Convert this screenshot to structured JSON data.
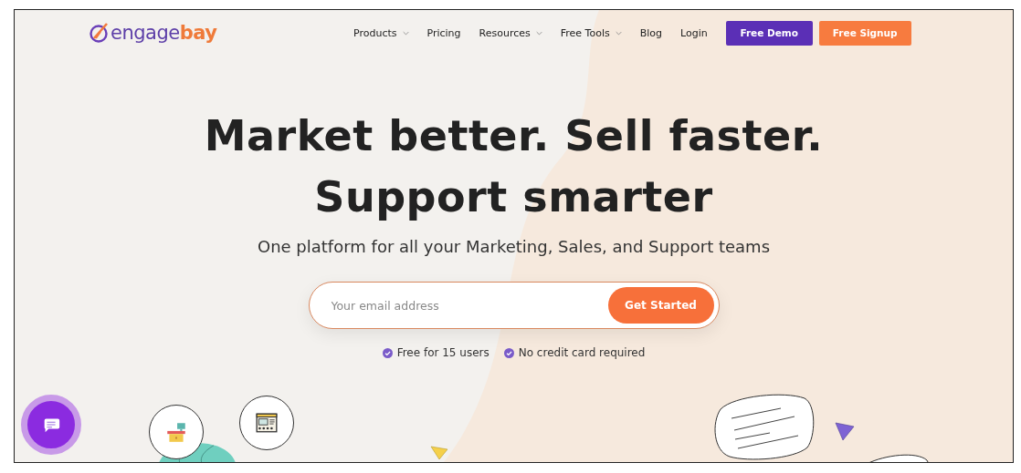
{
  "logo": {
    "text_main": "engage",
    "text_accent": "bay"
  },
  "nav": [
    {
      "label": "Products",
      "has_dropdown": true
    },
    {
      "label": "Pricing",
      "has_dropdown": false
    },
    {
      "label": "Resources",
      "has_dropdown": true
    },
    {
      "label": "Free Tools",
      "has_dropdown": true
    },
    {
      "label": "Blog",
      "has_dropdown": false
    },
    {
      "label": "Login",
      "has_dropdown": false
    }
  ],
  "nav_buttons": [
    {
      "label": "Free Demo",
      "kind": "demo"
    },
    {
      "label": "Free Signup",
      "kind": "signup"
    }
  ],
  "hero": {
    "headline": [
      "Market better. Sell faster.",
      "Support smarter"
    ],
    "subtitle": "One platform for all your Marketing, Sales, and Support teams",
    "email": {
      "placeholder": "Your email address"
    },
    "cta": "Get Started",
    "perks": [
      "Free for 15 users",
      "No credit card required"
    ]
  }
}
